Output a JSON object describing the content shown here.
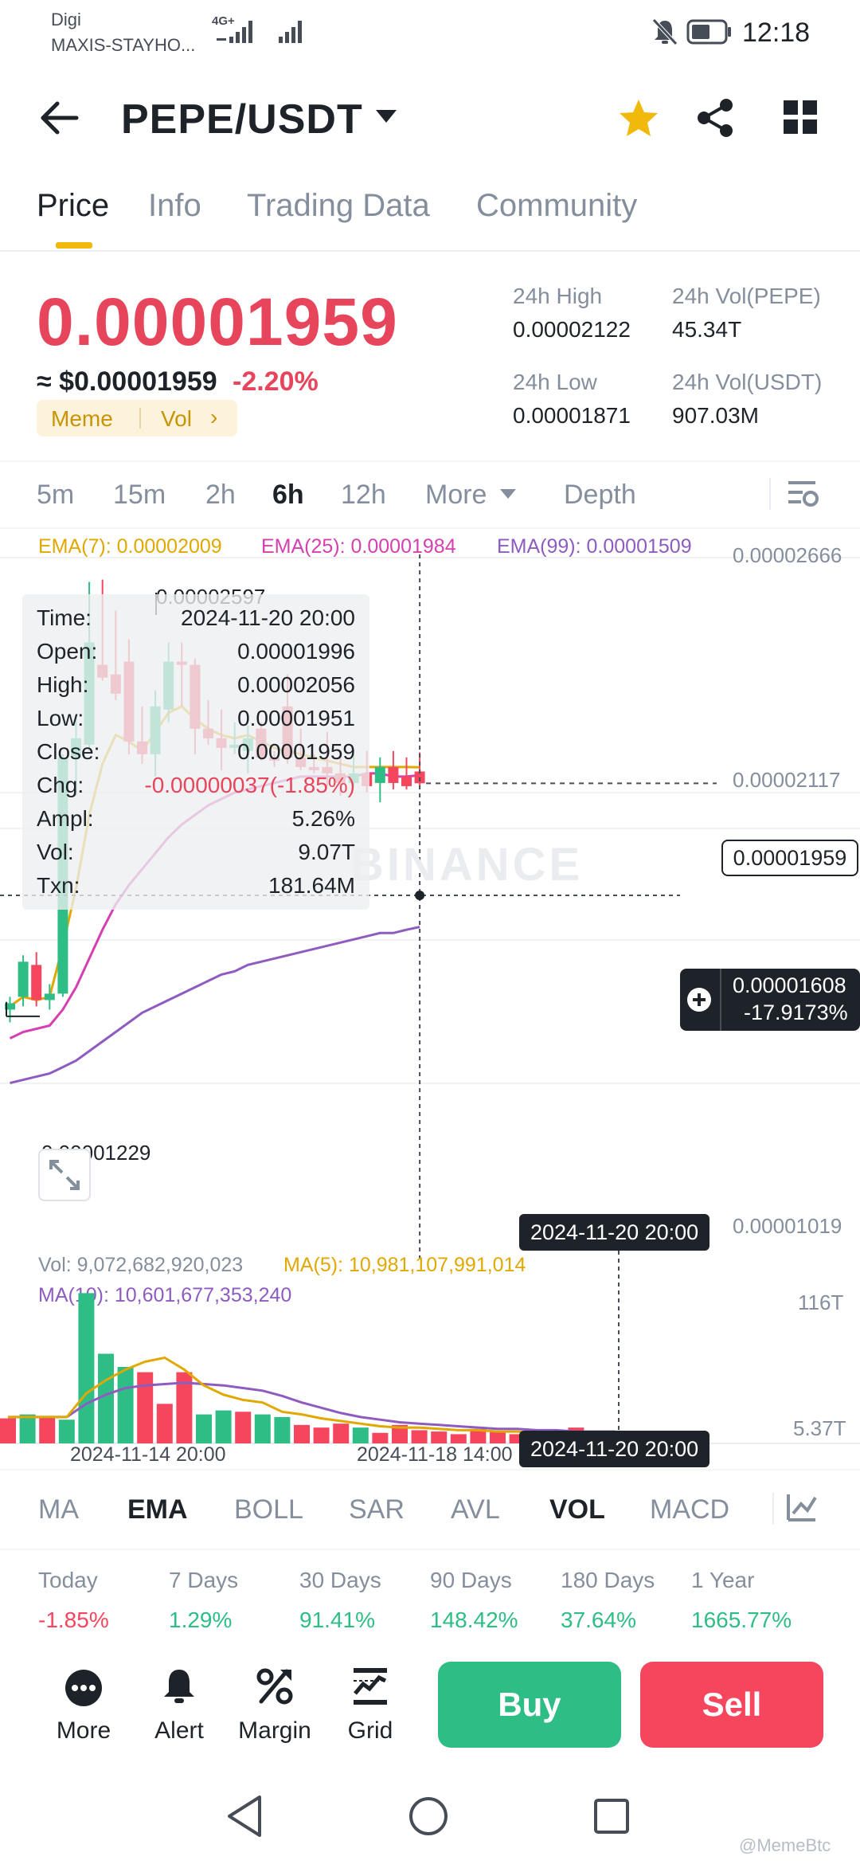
{
  "status_bar": {
    "carrier_line1": "Digi",
    "carrier_line2": "MAXIS-STAYHO...",
    "network_badge": "4G+",
    "time": "12:18"
  },
  "header": {
    "pair": "PEPE/USDT",
    "icons": [
      "back-arrow-icon",
      "dropdown-caret-icon",
      "star-icon",
      "share-icon",
      "grid-icon"
    ]
  },
  "tabs": [
    "Price",
    "Info",
    "Trading Data",
    "Community"
  ],
  "price": {
    "last": "0.00001959",
    "usd": "≈ $0.00001959",
    "change": "-2.20%",
    "tag1": "Meme",
    "tag2": "Vol",
    "high_label": "24h High",
    "high_value": "0.00002122",
    "vol_pepe_label": "24h Vol(PEPE)",
    "vol_pepe_value": "45.34T",
    "low_label": "24h Low",
    "low_value": "0.00001871",
    "vol_usdt_label": "24h Vol(USDT)",
    "vol_usdt_value": "907.03M"
  },
  "intervals": [
    "5m",
    "15m",
    "2h",
    "6h",
    "12h",
    "More",
    "Depth"
  ],
  "ema": {
    "ema7": "EMA(7): 0.00002009",
    "ema25": "EMA(25): 0.00001984",
    "ema99": "EMA(99): 0.00001509"
  },
  "chart_data": {
    "type": "candlestick",
    "y_axis": [
      "0.00002666",
      "0.00002117",
      "0.00001019"
    ],
    "ylim": [
      1.019e-05,
      2.666e-05
    ],
    "max_label": "0.00002597",
    "min_label": "0.00001229",
    "watermark": "BINANCE",
    "current_price_label": "0.00001959",
    "crosshair_value": "0.00001608",
    "crosshair_pct": "-17.9173%",
    "crosshair_date": "2024-11-20 20:00",
    "candles": [
      {
        "o": 1.25e-05,
        "h": 1.29e-05,
        "l": 1.21e-05,
        "c": 1.27e-05
      },
      {
        "o": 1.29e-05,
        "h": 1.42e-05,
        "l": 1.26e-05,
        "c": 1.4e-05
      },
      {
        "o": 1.39e-05,
        "h": 1.43e-05,
        "l": 1.26e-05,
        "c": 1.28e-05
      },
      {
        "o": 1.28e-05,
        "h": 1.33e-05,
        "l": 1.25e-05,
        "c": 1.3e-05
      },
      {
        "o": 1.3e-05,
        "h": 2.05e-05,
        "l": 1.29e-05,
        "c": 2.04e-05
      },
      {
        "o": 2.04e-05,
        "h": 2.17e-05,
        "l": 1.92e-05,
        "c": 2.1e-05
      },
      {
        "o": 2.08e-05,
        "h": 2.59e-05,
        "l": 2.06e-05,
        "c": 2.4e-05
      },
      {
        "o": 2.33e-05,
        "h": 2.597e-05,
        "l": 2.28e-05,
        "c": 2.29e-05
      },
      {
        "o": 2.3e-05,
        "h": 2.5e-05,
        "l": 2.22e-05,
        "c": 2.24e-05
      },
      {
        "o": 2.34e-05,
        "h": 2.41e-05,
        "l": 2.05e-05,
        "c": 2.09e-05
      },
      {
        "o": 2.09e-05,
        "h": 2.2e-05,
        "l": 2.02e-05,
        "c": 2.05e-05
      },
      {
        "o": 2.05e-05,
        "h": 2.25e-05,
        "l": 1.98e-05,
        "c": 2.2e-05
      },
      {
        "o": 2.19e-05,
        "h": 2.4e-05,
        "l": 2.15e-05,
        "c": 2.34e-05
      },
      {
        "o": 2.34e-05,
        "h": 2.4e-05,
        "l": 2.2e-05,
        "c": 2.33e-05
      },
      {
        "o": 2.33e-05,
        "h": 2.35e-05,
        "l": 2.05e-05,
        "c": 2.13e-05
      },
      {
        "o": 2.13e-05,
        "h": 2.22e-05,
        "l": 2.08e-05,
        "c": 2.1e-05
      },
      {
        "o": 2.1e-05,
        "h": 2.19e-05,
        "l": 2e-05,
        "c": 2.07e-05
      },
      {
        "o": 2.07e-05,
        "h": 2.15e-05,
        "l": 2.05e-05,
        "c": 2.08e-05
      },
      {
        "o": 2.06e-05,
        "h": 2.14e-05,
        "l": 1.99e-05,
        "c": 2.1e-05
      },
      {
        "o": 2.13e-05,
        "h": 2.15e-05,
        "l": 2.03e-05,
        "c": 2.04e-05
      },
      {
        "o": 2.04e-05,
        "h": 2.06e-05,
        "l": 2.01e-05,
        "c": 2.03e-05
      },
      {
        "o": 2.2e-05,
        "h": 2.3e-05,
        "l": 2.02e-05,
        "c": 2.04e-05
      },
      {
        "o": 2.04e-05,
        "h": 2.13e-05,
        "l": 2e-05,
        "c": 2.01e-05
      },
      {
        "o": 2.01e-05,
        "h": 2.05e-05,
        "l": 1.99e-05,
        "c": 2e-05
      },
      {
        "o": 2.01e-05,
        "h": 2.12e-05,
        "l": 1.95e-05,
        "c": 1.99e-05
      },
      {
        "o": 1.99e-05,
        "h": 2.04e-05,
        "l": 1.92e-05,
        "c": 1.96e-05
      },
      {
        "o": 1.96e-05,
        "h": 2.05e-05,
        "l": 1.95e-05,
        "c": 1.99e-05
      },
      {
        "o": 1.99e-05,
        "h": 2.06e-05,
        "l": 1.93e-05,
        "c": 1.95e-05
      },
      {
        "o": 1.96e-05,
        "h": 2.04e-05,
        "l": 1.9e-05,
        "c": 2.01e-05
      },
      {
        "o": 2.01e-05,
        "h": 2.06e-05,
        "l": 1.94e-05,
        "c": 1.96e-05
      },
      {
        "o": 1.98e-05,
        "h": 2.04e-05,
        "l": 1.94e-05,
        "c": 1.95e-05
      },
      {
        "o": 1.996e-05,
        "h": 2.056e-05,
        "l": 1.951e-05,
        "c": 1.959e-05
      }
    ],
    "ema7_series": [
      1.26e-05,
      1.29e-05,
      1.28e-05,
      1.29e-05,
      1.45e-05,
      1.63e-05,
      1.86e-05,
      2.02e-05,
      2.11e-05,
      2.09e-05,
      2.06e-05,
      2.12e-05,
      2.18e-05,
      2.2e-05,
      2.16e-05,
      2.13e-05,
      2.11e-05,
      2.1e-05,
      2.11e-05,
      2.09e-05,
      2.07e-05,
      2.06e-05,
      2.05e-05,
      2.04e-05,
      2.03e-05,
      2.02e-05,
      2.01e-05,
      2.01e-05,
      2.01e-05,
      2.01e-05,
      2.01e-05,
      2.009e-05
    ],
    "ema25_series": [
      1.16e-05,
      1.18e-05,
      1.19e-05,
      1.2e-05,
      1.25e-05,
      1.32e-05,
      1.41e-05,
      1.5e-05,
      1.58e-05,
      1.64e-05,
      1.69e-05,
      1.74e-05,
      1.79e-05,
      1.83e-05,
      1.86e-05,
      1.89e-05,
      1.91e-05,
      1.93e-05,
      1.94e-05,
      1.95e-05,
      1.96e-05,
      1.97e-05,
      1.98e-05,
      1.98e-05,
      1.98e-05,
      1.98e-05,
      1.98e-05,
      1.99e-05,
      1.99e-05,
      1.98e-05,
      1.98e-05,
      1.984e-05
    ],
    "ema99_series": [
      1.02e-05,
      1.03e-05,
      1.04e-05,
      1.05e-05,
      1.07e-05,
      1.09e-05,
      1.12e-05,
      1.15e-05,
      1.18e-05,
      1.21e-05,
      1.24e-05,
      1.26e-05,
      1.28e-05,
      1.3e-05,
      1.32e-05,
      1.34e-05,
      1.36e-05,
      1.37e-05,
      1.39e-05,
      1.4e-05,
      1.41e-05,
      1.42e-05,
      1.43e-05,
      1.44e-05,
      1.45e-05,
      1.46e-05,
      1.47e-05,
      1.48e-05,
      1.49e-05,
      1.49e-05,
      1.5e-05,
      1.509e-05
    ]
  },
  "tooltip": {
    "rows": [
      {
        "k": "Time:",
        "v": "2024-11-20 20:00"
      },
      {
        "k": "Open:",
        "v": "0.00001996"
      },
      {
        "k": "High:",
        "v": "0.00002056"
      },
      {
        "k": "Low:",
        "v": "0.00001951"
      },
      {
        "k": "Close:",
        "v": "0.00001959"
      },
      {
        "k": "Chg:",
        "v": "-0.00000037(-1.85%)"
      },
      {
        "k": "Ampl:",
        "v": "5.26%"
      },
      {
        "k": "Vol:",
        "v": "9.07T"
      },
      {
        "k": "Txn:",
        "v": "181.64M"
      }
    ]
  },
  "volume": {
    "vol_label": "Vol: 9,072,682,920,023",
    "ma5_label": "MA(5): 10,981,107,991,014",
    "ma10_label": "MA(10): 10,601,677,353,240",
    "y_top": "116T",
    "y_bottom": "5.37T",
    "ylim": [
      0,
      116
    ],
    "x_labels": [
      "2024-11-14 20:00",
      "2024-11-18 14:00"
    ],
    "bars": [
      {
        "v": 19,
        "up": false
      },
      {
        "v": 22,
        "up": true
      },
      {
        "v": 20,
        "up": false
      },
      {
        "v": 18,
        "up": true
      },
      {
        "v": 114,
        "up": true
      },
      {
        "v": 68,
        "up": true
      },
      {
        "v": 58,
        "up": true
      },
      {
        "v": 54,
        "up": false
      },
      {
        "v": 30,
        "up": false
      },
      {
        "v": 54,
        "up": false
      },
      {
        "v": 22,
        "up": true
      },
      {
        "v": 25,
        "up": true
      },
      {
        "v": 24,
        "up": false
      },
      {
        "v": 22,
        "up": true
      },
      {
        "v": 20,
        "up": true
      },
      {
        "v": 14,
        "up": false
      },
      {
        "v": 12,
        "up": false
      },
      {
        "v": 15,
        "up": false
      },
      {
        "v": 12,
        "up": true
      },
      {
        "v": 8,
        "up": false
      },
      {
        "v": 14,
        "up": false
      },
      {
        "v": 10,
        "up": false
      },
      {
        "v": 9,
        "up": false
      },
      {
        "v": 7,
        "up": false
      },
      {
        "v": 11,
        "up": false
      },
      {
        "v": 9,
        "up": false
      },
      {
        "v": 7,
        "up": false
      },
      {
        "v": 6,
        "up": false
      },
      {
        "v": 8,
        "up": true
      },
      {
        "v": 12,
        "up": false
      },
      {
        "v": 7,
        "up": false
      },
      {
        "v": 9,
        "up": false
      }
    ],
    "ma5_series": [
      20,
      20,
      20,
      20,
      38,
      48,
      56,
      62,
      65,
      56,
      44,
      37,
      33,
      31,
      24,
      22,
      19,
      17,
      15,
      13,
      12,
      12,
      11,
      10,
      10,
      9,
      9,
      8,
      8,
      8,
      8,
      8
    ],
    "ma10_series": [
      20,
      20,
      20,
      20,
      30,
      37,
      42,
      44,
      45,
      46,
      45,
      44,
      42,
      40,
      36,
      31,
      27,
      23,
      20,
      18,
      16,
      15,
      14,
      13,
      12,
      11,
      11,
      10,
      10,
      9,
      9,
      9
    ]
  },
  "indicators": [
    "MA",
    "EMA",
    "BOLL",
    "SAR",
    "AVL",
    "VOL",
    "MACD"
  ],
  "performance": [
    {
      "label": "Today",
      "value": "-1.85%",
      "neg": true
    },
    {
      "label": "7 Days",
      "value": "1.29%",
      "neg": false
    },
    {
      "label": "30 Days",
      "value": "91.41%",
      "neg": false
    },
    {
      "label": "90 Days",
      "value": "148.42%",
      "neg": false
    },
    {
      "label": "180 Days",
      "value": "37.64%",
      "neg": false
    },
    {
      "label": "1 Year",
      "value": "1665.77%",
      "neg": false
    }
  ],
  "actions": {
    "more": "More",
    "alert": "Alert",
    "margin": "Margin",
    "grid": "Grid",
    "buy": "Buy",
    "sell": "Sell"
  },
  "colors": {
    "up": "#2ebd85",
    "down": "#f6465d",
    "accent": "#f0b90b",
    "ema7": "#e0a800",
    "ema25": "#d63fb0",
    "ema99": "#8e5cc0"
  },
  "watermark_corner": "@MemeBtc"
}
